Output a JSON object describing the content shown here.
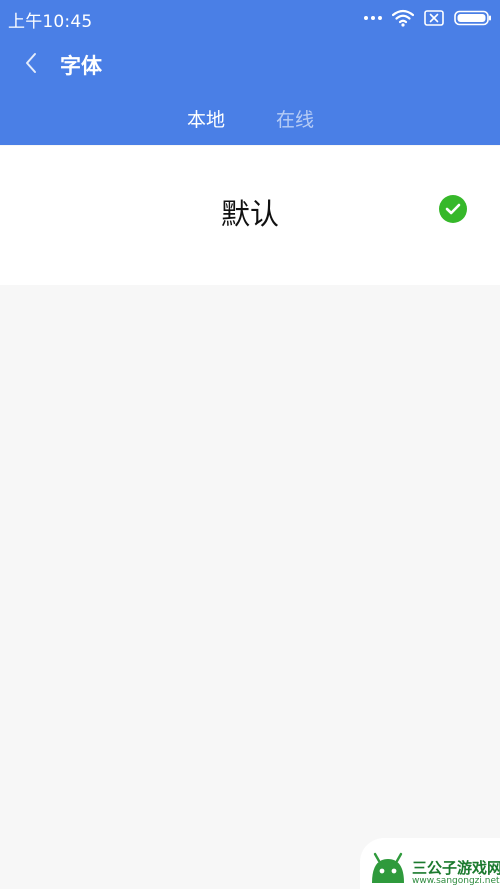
{
  "status_bar": {
    "time": "上午10:45",
    "icons": [
      "more-dots-icon",
      "wifi-icon",
      "no-sim-icon",
      "battery-icon"
    ]
  },
  "title_bar": {
    "back_icon": "back-arrow-icon",
    "title": "字体"
  },
  "tabs": [
    {
      "label": "本地",
      "active": true
    },
    {
      "label": "在线",
      "active": false
    }
  ],
  "font_list": {
    "items": [
      {
        "label": "默认",
        "selected": true,
        "status_icon": "check-circle-icon"
      }
    ]
  },
  "watermark": {
    "title": "三公子游戏网",
    "url": "www.sangongzi.net"
  },
  "colors": {
    "header_bg": "#4a7fe6",
    "page_bg": "#f7f7f7",
    "selected_check": "#36b82a"
  }
}
